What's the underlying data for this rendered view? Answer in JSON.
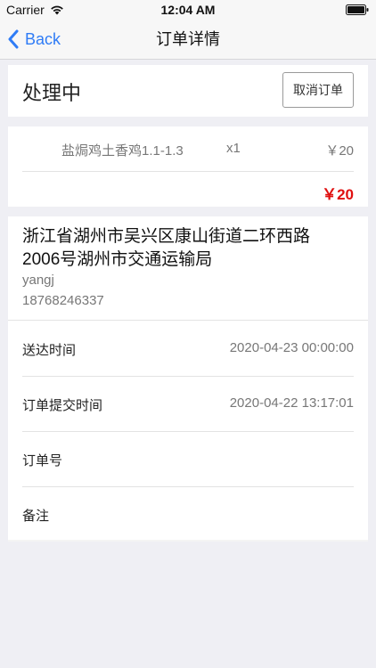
{
  "status_bar": {
    "carrier": "Carrier",
    "time": "12:04 AM"
  },
  "nav": {
    "back_label": "Back",
    "title": "订单详情"
  },
  "order_status": {
    "status": "处理中",
    "cancel_label": "取消订单"
  },
  "items": [
    {
      "name": "盐焗鸡土香鸡1.1-1.3",
      "qty": "x1",
      "price": "￥20"
    }
  ],
  "total": "￥20",
  "address": {
    "full": "浙江省湖州市吴兴区康山街道二环西路2006号湖州市交通运输局",
    "name": "yangj",
    "phone": "18768246337"
  },
  "info": {
    "delivery_time_label": "送达时间",
    "delivery_time_value": "2020-04-23 00:00:00",
    "submit_time_label": "订单提交时间",
    "submit_time_value": "2020-04-22 13:17:01",
    "order_number_label": "订单号",
    "order_number_value": "",
    "remark_label": "备注",
    "remark_value": ""
  },
  "colors": {
    "accent": "#2f7cf6",
    "price_red": "#e01010",
    "background": "#efeff4"
  }
}
